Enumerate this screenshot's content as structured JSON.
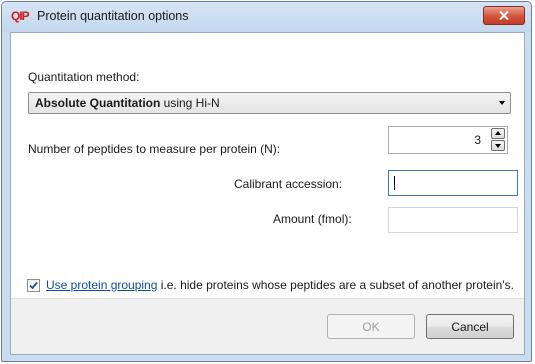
{
  "window": {
    "logo": "QIP",
    "title": "Protein quantitation options",
    "close_icon": "close-x-icon"
  },
  "quantitation_method": {
    "label": "Quantitation method:",
    "selected_bold": "Absolute Quantitation",
    "selected_rest": " using Hi-N"
  },
  "peptides": {
    "label": "Number of peptides to measure per protein (N):",
    "value": "3"
  },
  "calibrant": {
    "label": "Calibrant accession:",
    "value": ""
  },
  "amount": {
    "label": "Amount (fmol):",
    "value": ""
  },
  "grouping": {
    "checked": true,
    "link_text": "Use protein grouping",
    "rest_text": " i.e. hide proteins whose peptides are a subset of another protein's."
  },
  "buttons": {
    "ok": "OK",
    "cancel": "Cancel"
  },
  "colors": {
    "link": "#0e4fa6",
    "logo": "#d11a1a",
    "close_button": "#c9462f"
  }
}
